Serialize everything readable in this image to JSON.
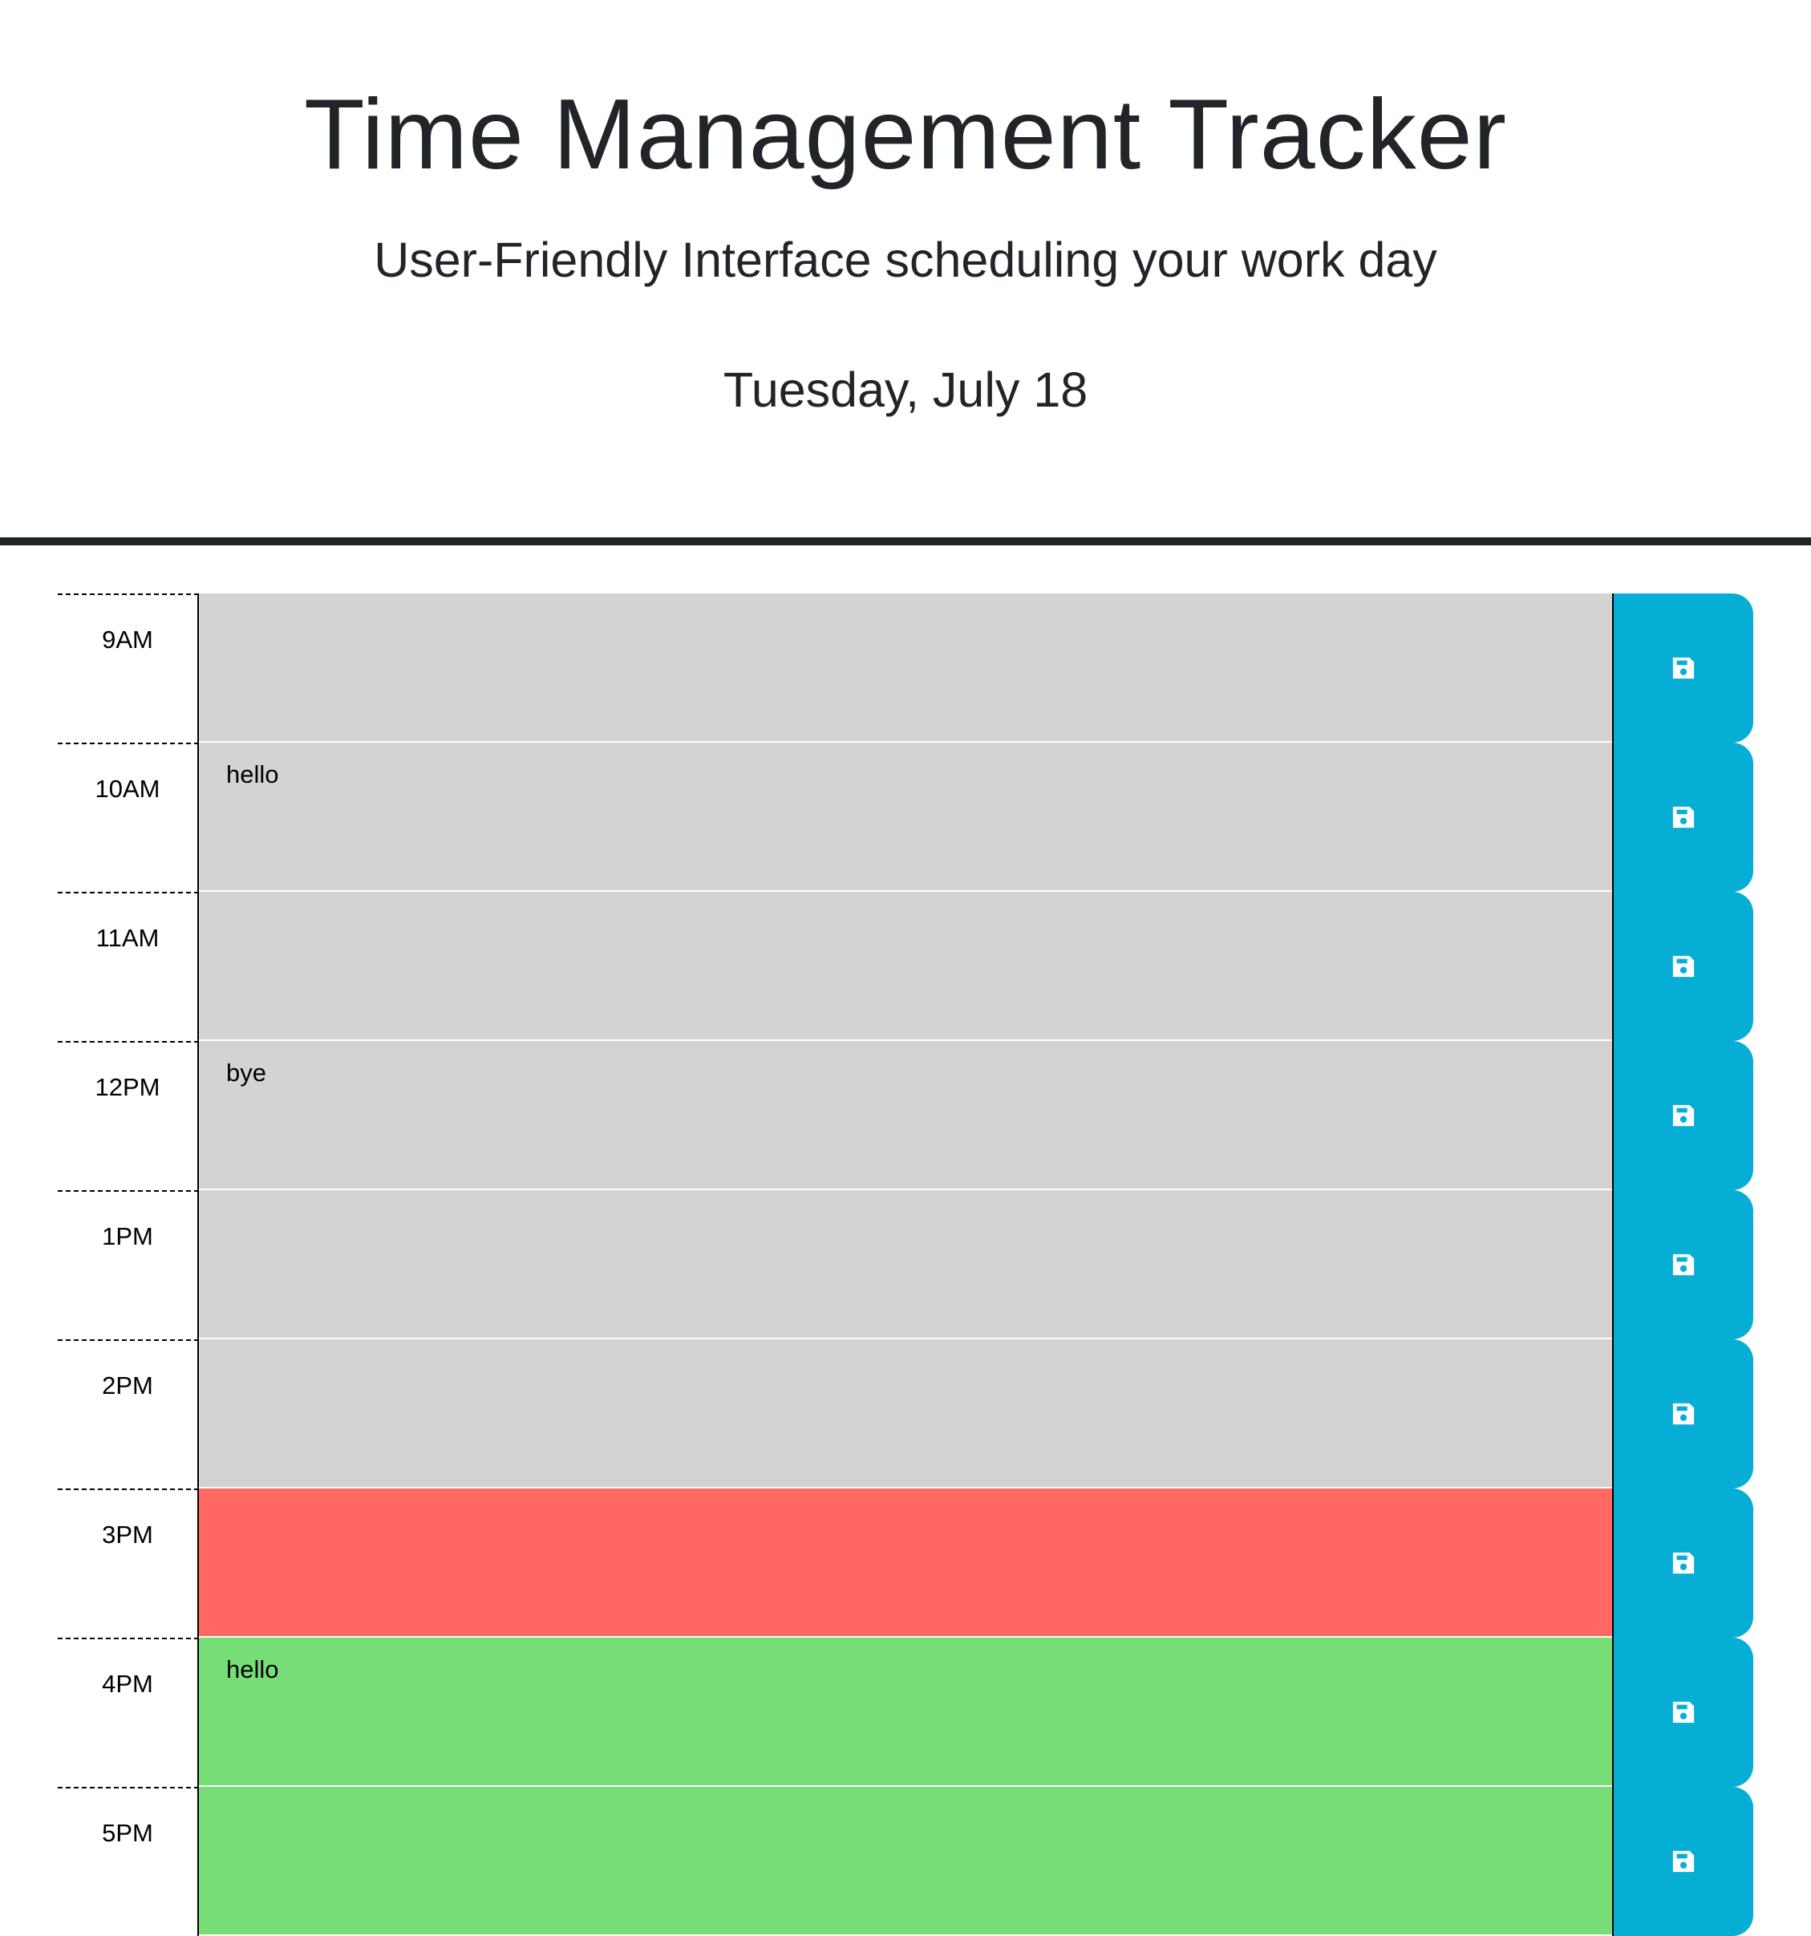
{
  "header": {
    "title": "Time Management Tracker",
    "subtitle": "User-Friendly Interface scheduling your work day",
    "date": "Tuesday, July 18"
  },
  "colors": {
    "past": "#d3d3d3",
    "present": "#ff6961",
    "future": "#77dd77",
    "save_button": "#06aed5"
  },
  "schedule": {
    "blocks": [
      {
        "hour": "9AM",
        "text": "",
        "status": "past",
        "icon": "save-icon"
      },
      {
        "hour": "10AM",
        "text": "hello",
        "status": "past",
        "icon": "save-icon"
      },
      {
        "hour": "11AM",
        "text": "",
        "status": "past",
        "icon": "save-icon"
      },
      {
        "hour": "12PM",
        "text": "bye",
        "status": "past",
        "icon": "save-icon"
      },
      {
        "hour": "1PM",
        "text": "",
        "status": "past",
        "icon": "save-icon"
      },
      {
        "hour": "2PM",
        "text": "",
        "status": "past",
        "icon": "save-icon"
      },
      {
        "hour": "3PM",
        "text": "",
        "status": "present",
        "icon": "save-icon"
      },
      {
        "hour": "4PM",
        "text": "hello",
        "status": "future",
        "icon": "save-icon"
      },
      {
        "hour": "5PM",
        "text": "",
        "status": "future",
        "icon": "save-icon"
      }
    ]
  }
}
